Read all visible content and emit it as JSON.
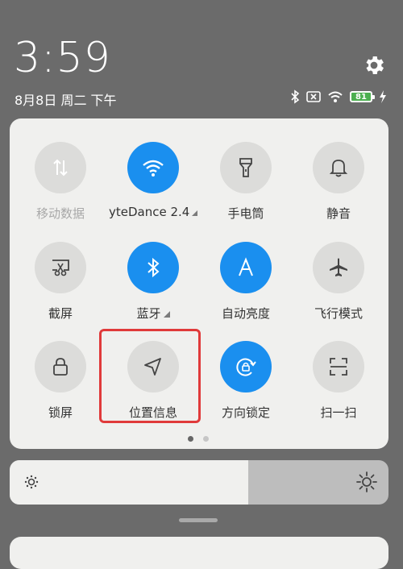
{
  "status": {
    "time": "3:59",
    "date": "8月8日 周二 下午",
    "battery": "81"
  },
  "tiles": [
    {
      "id": "mobile-data",
      "label": "移动数据",
      "icon": "mobile-data-icon",
      "active": false,
      "dim": true
    },
    {
      "id": "wifi",
      "label": "yteDance 2.4",
      "icon": "wifi-icon",
      "active": true,
      "arrow": true
    },
    {
      "id": "flashlight",
      "label": "手电筒",
      "icon": "flashlight-icon",
      "active": false
    },
    {
      "id": "silent",
      "label": "静音",
      "icon": "bell-icon",
      "active": false
    },
    {
      "id": "screenshot",
      "label": "截屏",
      "icon": "screenshot-icon",
      "active": false
    },
    {
      "id": "bluetooth",
      "label": "蓝牙",
      "icon": "bluetooth-icon",
      "active": true,
      "arrow": true
    },
    {
      "id": "auto-brightness",
      "label": "自动亮度",
      "icon": "auto-brightness-icon",
      "active": true
    },
    {
      "id": "airplane",
      "label": "飞行模式",
      "icon": "airplane-icon",
      "active": false
    },
    {
      "id": "lock",
      "label": "锁屏",
      "icon": "lock-icon",
      "active": false
    },
    {
      "id": "location",
      "label": "位置信息",
      "icon": "location-icon",
      "active": false
    },
    {
      "id": "rotation-lock",
      "label": "方向锁定",
      "icon": "rotation-lock-icon",
      "active": true
    },
    {
      "id": "scan",
      "label": "扫一扫",
      "icon": "scan-icon",
      "active": false
    }
  ],
  "pagination": {
    "pages": 2,
    "current": 1
  },
  "brightness": {
    "level": 0.63
  },
  "colors": {
    "active": "#1a8fef",
    "inactive": "#dcdcda",
    "highlight": "#e03a3a"
  }
}
